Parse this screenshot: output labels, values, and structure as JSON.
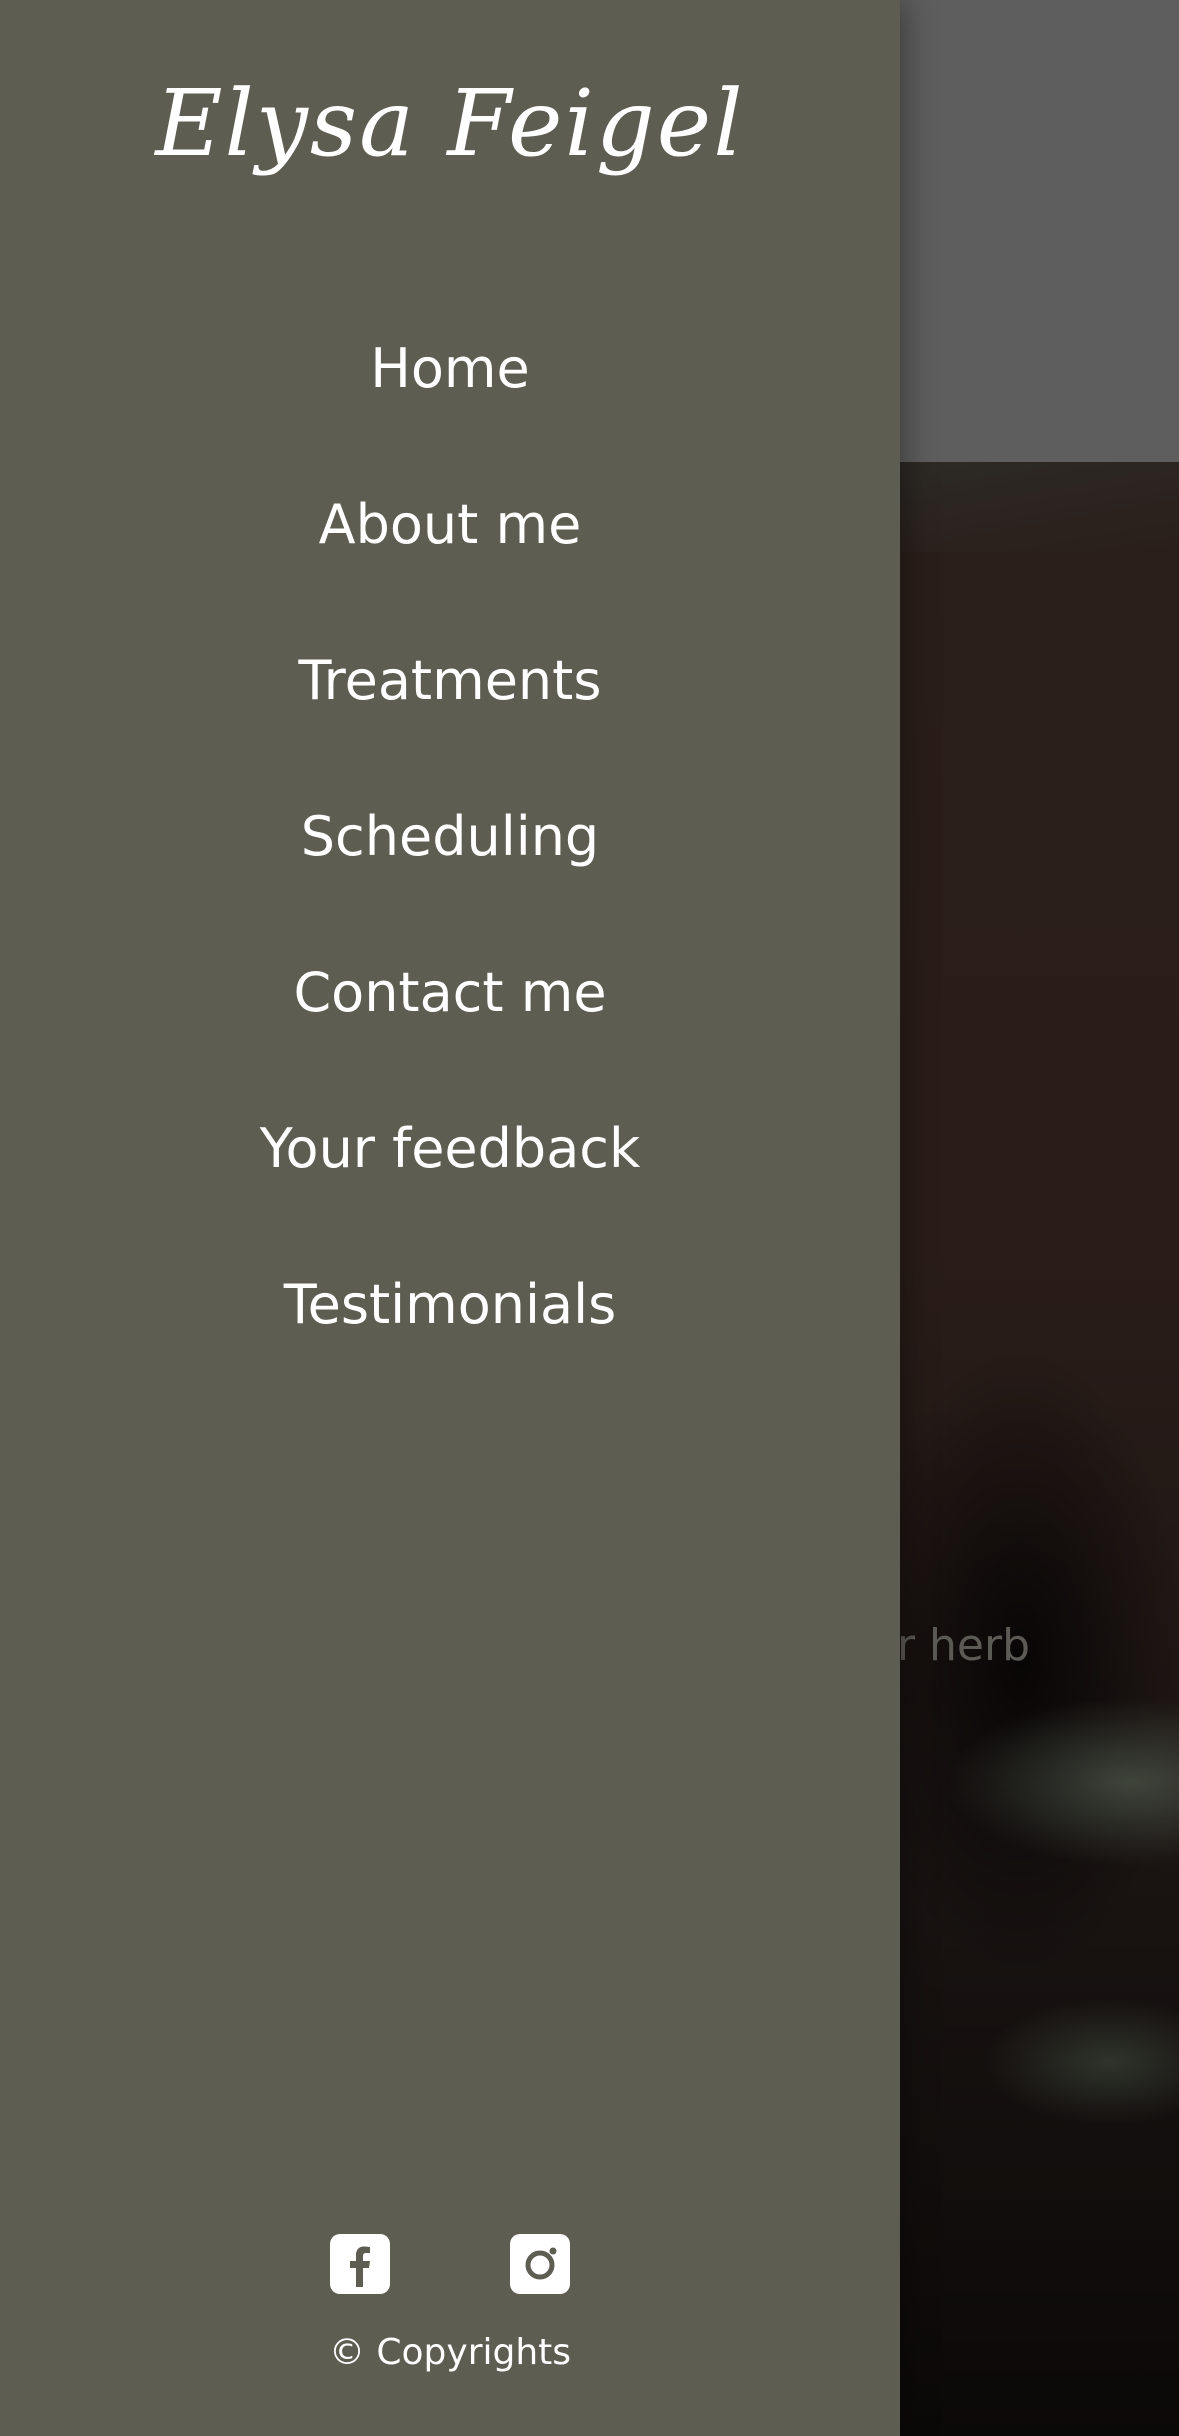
{
  "brand": {
    "name": "Elysa Feigel"
  },
  "nav": {
    "items": [
      {
        "label": "Home"
      },
      {
        "label": "About me"
      },
      {
        "label": "Treatments"
      },
      {
        "label": "Scheduling"
      },
      {
        "label": "Contact me"
      },
      {
        "label": "Your feedback"
      },
      {
        "label": "Testimonials"
      }
    ]
  },
  "socials": {
    "facebook_icon": "facebook-icon",
    "instagram_icon": "instagram-icon"
  },
  "footer": {
    "copyright": "© Copyrights"
  },
  "background": {
    "hero_text_fragment": "er herb"
  },
  "colors": {
    "drawer": "#5d5d52",
    "header_bg": "#5e5e5e",
    "text": "#ffffff"
  }
}
